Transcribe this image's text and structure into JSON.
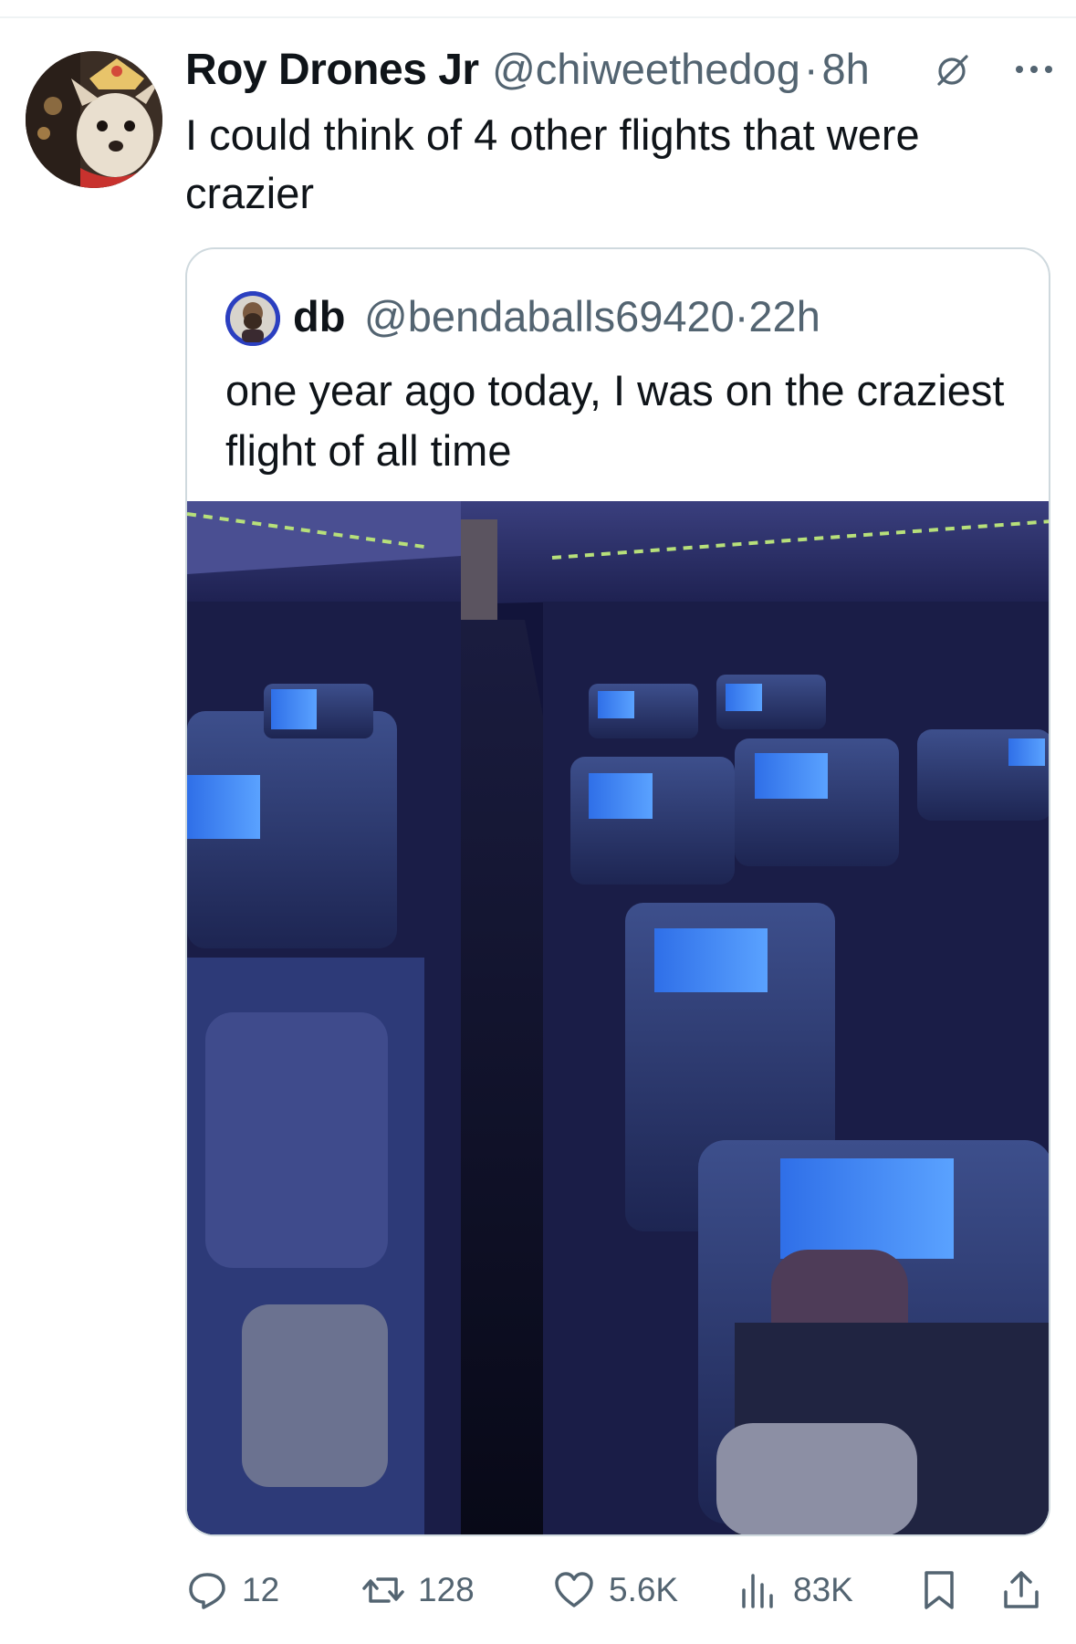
{
  "tweet": {
    "display_name": "Roy Drones Jr",
    "handle": "@chiweethedog",
    "separator": "·",
    "time": "8h",
    "text": "I could think of 4 other flights that were crazier",
    "avatar_icon": "dog-avatar",
    "grok_icon": "grok-icon",
    "more_icon": "more-icon"
  },
  "quote": {
    "display_name": "db",
    "handle": "@bendaballs69420",
    "separator": "·",
    "time": "22h",
    "text": "one year ago today, I was on the craziest flight of all time",
    "media_description_icon": "airplane-cabin-photo"
  },
  "actions": {
    "replies": "12",
    "reposts": "128",
    "likes": "5.6K",
    "views": "83K"
  },
  "colors": {
    "text_primary": "#0f1419",
    "text_secondary": "#536471",
    "border": "#cfd9de"
  }
}
